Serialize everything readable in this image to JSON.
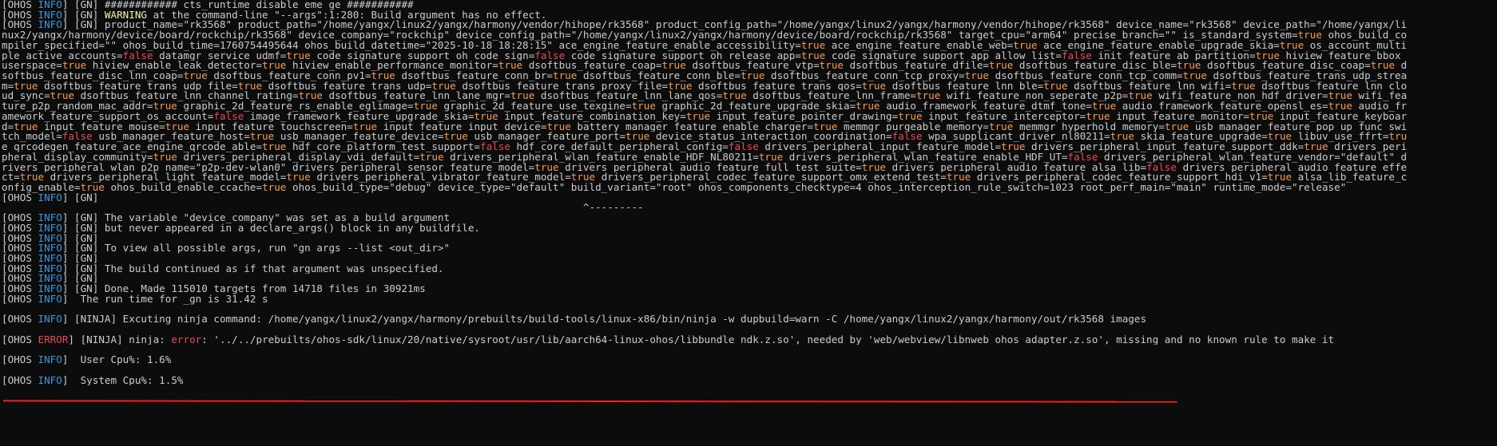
{
  "tags": {
    "info": "INFO",
    "error": "ERROR"
  },
  "colors": {
    "background": "#0c0c0c",
    "foreground": "#cccccc",
    "info_tag": "#3a96dd",
    "error_tag": "#e74856",
    "warning": "#f9f1a5",
    "bool_true": "#f59c4f",
    "bool_false": "#e74856",
    "annotation": "#ff1a1a"
  },
  "lines": [
    [
      [
        "",
        "[OHOS "
      ],
      [
        "info",
        "INFO"
      ],
      [
        "",
        "] [GN] ############ cts_runtime disable eme ge ###########"
      ]
    ],
    [
      [
        "",
        "[OHOS "
      ],
      [
        "info",
        "INFO"
      ],
      [
        "",
        "] [GN] "
      ],
      [
        "warn",
        "WARNING"
      ],
      [
        "",
        " at the command-line \"--args\":1:280: Build argument has no effect."
      ]
    ],
    [
      [
        "",
        "[OHOS "
      ],
      [
        "info",
        "INFO"
      ],
      [
        "",
        "] [GN] product_name=\"rk3568\" product_path=\"/home/yangx/linux2/yangx/harmony/vendor/hihope/rk3568\" product_config_path=\"/home/yangx/linux2/yangx/harmony/vendor/hihope/rk3568\" device_name=\"rk3568\" device_path=\"/home/yangx/li"
      ]
    ],
    [
      [
        "",
        "nux2/yangx/harmony/device/board/rockchip/rk3568\" device_company=\"rockchip\" device_config_path=\"/home/yangx/linux2/yangx/harmony/device/board/rockchip/rk3568\" target_cpu=\"arm64\" precise_branch=\"\" is_standard_system="
      ],
      [
        "t",
        "true"
      ],
      [
        "",
        " ohos_build_co"
      ]
    ],
    [
      [
        "",
        "mpiler_specified=\"\" ohos_build_time=1760754495644 ohos_build_datetime=\"2025-10-18 18:28:15\" ace_engine_feature_enable_accessibility="
      ],
      [
        "t",
        "true"
      ],
      [
        "",
        " ace_engine_feature_enable_web="
      ],
      [
        "t",
        "true"
      ],
      [
        "",
        " ace_engine_feature_enable_upgrade_skia="
      ],
      [
        "t",
        "true"
      ],
      [
        "",
        " os_account_multi"
      ]
    ],
    [
      [
        "",
        "ple_active_accounts="
      ],
      [
        "f",
        "false"
      ],
      [
        "",
        " datamgr_service_udmf="
      ],
      [
        "t",
        "true"
      ],
      [
        "",
        " code_signature_support_oh_code_sign="
      ],
      [
        "f",
        "false"
      ],
      [
        "",
        " code_signature_support_oh_release_app="
      ],
      [
        "t",
        "true"
      ],
      [
        "",
        " code_signature_support_app_allow_list="
      ],
      [
        "f",
        "false"
      ],
      [
        "",
        " init_feature_ab_partition="
      ],
      [
        "t",
        "true"
      ],
      [
        "",
        " hiview_feature_bbox_"
      ]
    ],
    [
      [
        "",
        "userspace="
      ],
      [
        "t",
        "true"
      ],
      [
        "",
        " hiview_enable_leak_detector="
      ],
      [
        "t",
        "true"
      ],
      [
        "",
        " hiview_enable_performance_monitor="
      ],
      [
        "t",
        "true"
      ],
      [
        "",
        " dsoftbus_feature_coap="
      ],
      [
        "t",
        "true"
      ],
      [
        "",
        " dsoftbus_feature_vtp="
      ],
      [
        "t",
        "true"
      ],
      [
        "",
        " dsoftbus_feature_dfile="
      ],
      [
        "t",
        "true"
      ],
      [
        "",
        " dsoftbus_feature_disc_ble="
      ],
      [
        "t",
        "true"
      ],
      [
        "",
        " dsoftbus_feature_disc_coap="
      ],
      [
        "t",
        "true"
      ],
      [
        "",
        " d"
      ]
    ],
    [
      [
        "",
        "softbus_feature_disc_lnn_coap="
      ],
      [
        "t",
        "true"
      ],
      [
        "",
        " dsoftbus_feature_conn_pv1="
      ],
      [
        "t",
        "true"
      ],
      [
        "",
        " dsoftbus_feature_conn_br="
      ],
      [
        "t",
        "true"
      ],
      [
        "",
        " dsoftbus_feature_conn_ble="
      ],
      [
        "t",
        "true"
      ],
      [
        "",
        " dsoftbus_feature_conn_tcp_proxy="
      ],
      [
        "t",
        "true"
      ],
      [
        "",
        " dsoftbus_feature_conn_tcp_comm="
      ],
      [
        "t",
        "true"
      ],
      [
        "",
        " dsoftbus_feature_trans_udp_strea"
      ]
    ],
    [
      [
        "",
        "m="
      ],
      [
        "t",
        "true"
      ],
      [
        "",
        " dsoftbus_feature_trans_udp_file="
      ],
      [
        "t",
        "true"
      ],
      [
        "",
        " dsoftbus_feature_trans_udp="
      ],
      [
        "t",
        "true"
      ],
      [
        "",
        " dsoftbus_feature_trans_proxy_file="
      ],
      [
        "t",
        "true"
      ],
      [
        "",
        " dsoftbus_feature_trans_qos="
      ],
      [
        "t",
        "true"
      ],
      [
        "",
        " dsoftbus_feature_lnn_ble="
      ],
      [
        "t",
        "true"
      ],
      [
        "",
        " dsoftbus_feature_lnn_wifi="
      ],
      [
        "t",
        "true"
      ],
      [
        "",
        " dsoftbus_feature_lnn_clo"
      ]
    ],
    [
      [
        "",
        "ud_sync="
      ],
      [
        "t",
        "true"
      ],
      [
        "",
        " dsoftbus_feature_lnn_channel_rating="
      ],
      [
        "t",
        "true"
      ],
      [
        "",
        " dsoftbus_feature_lnn_lane_mgr="
      ],
      [
        "t",
        "true"
      ],
      [
        "",
        " dsoftbus_feature_lnn_lane_qos="
      ],
      [
        "t",
        "true"
      ],
      [
        "",
        " dsoftbus_feature_lnn_frame="
      ],
      [
        "t",
        "true"
      ],
      [
        "",
        " wifi_feature_non_seperate_p2p="
      ],
      [
        "t",
        "true"
      ],
      [
        "",
        " wifi_feature_non_hdf_driver="
      ],
      [
        "t",
        "true"
      ],
      [
        "",
        " wifi_fea"
      ]
    ],
    [
      [
        "",
        "ture_p2p_random_mac_addr="
      ],
      [
        "t",
        "true"
      ],
      [
        "",
        " graphic_2d_feature_rs_enable_eglimage="
      ],
      [
        "t",
        "true"
      ],
      [
        "",
        " graphic_2d_feature_use_texgine="
      ],
      [
        "t",
        "true"
      ],
      [
        "",
        " graphic_2d_feature_upgrade_skia="
      ],
      [
        "t",
        "true"
      ],
      [
        "",
        " audio_framework_feature_dtmf_tone="
      ],
      [
        "t",
        "true"
      ],
      [
        "",
        " audio_framework_feature_opensl_es="
      ],
      [
        "t",
        "true"
      ],
      [
        "",
        " audio_fr"
      ]
    ],
    [
      [
        "",
        "amework_feature_support_os_account="
      ],
      [
        "f",
        "false"
      ],
      [
        "",
        " image_framework_feature_upgrade_skia="
      ],
      [
        "t",
        "true"
      ],
      [
        "",
        " input_feature_combination_key="
      ],
      [
        "t",
        "true"
      ],
      [
        "",
        " input_feature_pointer_drawing="
      ],
      [
        "t",
        "true"
      ],
      [
        "",
        " input_feature_interceptor="
      ],
      [
        "t",
        "true"
      ],
      [
        "",
        " input_feature_monitor="
      ],
      [
        "t",
        "true"
      ],
      [
        "",
        " input_feature_keyboar"
      ]
    ],
    [
      [
        "",
        "d="
      ],
      [
        "t",
        "true"
      ],
      [
        "",
        " input_feature_mouse="
      ],
      [
        "t",
        "true"
      ],
      [
        "",
        " input_feature_touchscreen="
      ],
      [
        "t",
        "true"
      ],
      [
        "",
        " input_feature_input_device="
      ],
      [
        "t",
        "true"
      ],
      [
        "",
        " battery_manager_feature_enable_charger="
      ],
      [
        "t",
        "true"
      ],
      [
        "",
        " memmgr_purgeable_memory="
      ],
      [
        "t",
        "true"
      ],
      [
        "",
        " memmgr_hyperhold_memory="
      ],
      [
        "t",
        "true"
      ],
      [
        "",
        " usb_manager_feature_pop_up_func_swi"
      ]
    ],
    [
      [
        "",
        "tch_model="
      ],
      [
        "f",
        "false"
      ],
      [
        "",
        " usb_manager_feature_host="
      ],
      [
        "t",
        "true"
      ],
      [
        "",
        " usb_manager_feature_device="
      ],
      [
        "t",
        "true"
      ],
      [
        "",
        " usb_manager_feature_port="
      ],
      [
        "t",
        "true"
      ],
      [
        "",
        " device_status_interaction_coordination="
      ],
      [
        "f",
        "false"
      ],
      [
        "",
        " wpa_supplicant_driver_nl80211="
      ],
      [
        "t",
        "true"
      ],
      [
        "",
        " skia_feature_upgrade="
      ],
      [
        "t",
        "true"
      ],
      [
        "",
        " libuv_use_ffrt="
      ],
      [
        "t",
        "tru"
      ]
    ],
    [
      [
        "",
        "e qrcodegen_feature_ace_engine_qrcode_able="
      ],
      [
        "t",
        "true"
      ],
      [
        "",
        " hdf_core_platform_test_support="
      ],
      [
        "f",
        "false"
      ],
      [
        "",
        " hdf_core_default_peripheral_config="
      ],
      [
        "f",
        "false"
      ],
      [
        "",
        " drivers_peripheral_input_feature_model="
      ],
      [
        "t",
        "true"
      ],
      [
        "",
        " drivers_peripheral_input_feature_support_ddk="
      ],
      [
        "t",
        "true"
      ],
      [
        "",
        " drivers_peri"
      ]
    ],
    [
      [
        "",
        "pheral_display_community="
      ],
      [
        "t",
        "true"
      ],
      [
        "",
        " drivers_peripheral_display_vdi_default="
      ],
      [
        "t",
        "true"
      ],
      [
        "",
        " drivers_peripheral_wlan_feature_enable_HDF_NL80211="
      ],
      [
        "t",
        "true"
      ],
      [
        "",
        " drivers_peripheral_wlan_feature_enable_HDF_UT="
      ],
      [
        "f",
        "false"
      ],
      [
        "",
        " drivers_peripheral_wlan_feature_vendor=\"default\" d"
      ]
    ],
    [
      [
        "",
        "rivers_peripheral_wlan_p2p_name=\"p2p-dev-wlan0\" drivers_peripheral_sensor_feature_model="
      ],
      [
        "t",
        "true"
      ],
      [
        "",
        " drivers_peripheral_audio_feature_full_test_suite="
      ],
      [
        "t",
        "true"
      ],
      [
        "",
        " drivers_peripheral_audio_feature_alsa_lib="
      ],
      [
        "f",
        "false"
      ],
      [
        "",
        " drivers_peripheral_audio_feature_effe"
      ]
    ],
    [
      [
        "",
        "ct="
      ],
      [
        "t",
        "true"
      ],
      [
        "",
        " drivers_peripheral_light_feature_model="
      ],
      [
        "t",
        "true"
      ],
      [
        "",
        " drivers_peripheral_vibrator_feature_model="
      ],
      [
        "t",
        "true"
      ],
      [
        "",
        " drivers_peripheral_codec_feature_support_omx_extend_test="
      ],
      [
        "t",
        "true"
      ],
      [
        "",
        " drivers_peripheral_codec_feature_support_hdi_v1="
      ],
      [
        "t",
        "true"
      ],
      [
        "",
        " alsa_lib_feature_c"
      ]
    ],
    [
      [
        "",
        "onfig_enable="
      ],
      [
        "t",
        "true"
      ],
      [
        "",
        " ohos_build_enable_ccache="
      ],
      [
        "t",
        "true"
      ],
      [
        "",
        " ohos_build_type=\"debug\" device_type=\"default\" build_variant=\"root\" ohos_components_checktype=4 ohos_interception_rule_switch=1023 root_perf_main=\"main\" runtime_mode=\"release\""
      ]
    ],
    [
      [
        "",
        "[OHOS "
      ],
      [
        "info",
        "INFO"
      ],
      [
        "",
        "] [GN]"
      ]
    ],
    [
      [
        "caret",
        "                                                                                                ^---------"
      ]
    ],
    [
      [
        "",
        "[OHOS "
      ],
      [
        "info",
        "INFO"
      ],
      [
        "",
        "] [GN] The variable \"device_company\" was set as a build argument"
      ]
    ],
    [
      [
        "",
        "[OHOS "
      ],
      [
        "info",
        "INFO"
      ],
      [
        "",
        "] [GN] but never appeared in a declare_args() block in any buildfile."
      ]
    ],
    [
      [
        "",
        "[OHOS "
      ],
      [
        "info",
        "INFO"
      ],
      [
        "",
        "] [GN]"
      ]
    ],
    [
      [
        "",
        "[OHOS "
      ],
      [
        "info",
        "INFO"
      ],
      [
        "",
        "] [GN] To view all possible args, run \"gn args --list <out_dir>\""
      ]
    ],
    [
      [
        "",
        "[OHOS "
      ],
      [
        "info",
        "INFO"
      ],
      [
        "",
        "] [GN]"
      ]
    ],
    [
      [
        "",
        "[OHOS "
      ],
      [
        "info",
        "INFO"
      ],
      [
        "",
        "] [GN] The build continued as if that argument was unspecified."
      ]
    ],
    [
      [
        "",
        "[OHOS "
      ],
      [
        "info",
        "INFO"
      ],
      [
        "",
        "] [GN]"
      ]
    ],
    [
      [
        "",
        "[OHOS "
      ],
      [
        "info",
        "INFO"
      ],
      [
        "",
        "] [GN] Done. Made 115010 targets from 14718 files in 30921ms"
      ]
    ],
    [
      [
        "",
        "[OHOS "
      ],
      [
        "info",
        "INFO"
      ],
      [
        "",
        "]  The run time for _gn is 31.42 s"
      ]
    ],
    [],
    [
      [
        "",
        "[OHOS "
      ],
      [
        "info",
        "INFO"
      ],
      [
        "",
        "] [NINJA] Excuting ninja command: /home/yangx/linux2/yangx/harmony/prebuilts/build-tools/linux-x86/bin/ninja -w dupbuild=warn -C /home/yangx/linux2/yangx/harmony/out/rk3568 images"
      ]
    ],
    [],
    [
      [
        "",
        "[OHOS "
      ],
      [
        "err",
        "ERROR"
      ],
      [
        "",
        "] [NINJA] ninja: "
      ],
      [
        "err",
        "error"
      ],
      [
        "",
        ": '../../prebuilts/ohos-sdk/linux/20/native/sysroot/usr/lib/aarch64-linux-ohos/libbundle_ndk.z.so', needed by 'web/webview/libnweb_ohos_adapter.z.so', missing and no known rule to make it"
      ]
    ],
    [],
    [
      [
        "",
        "[OHOS "
      ],
      [
        "info",
        "INFO"
      ],
      [
        "",
        "]  User Cpu%: 1.6%"
      ]
    ],
    [],
    [
      [
        "",
        "[OHOS "
      ],
      [
        "info",
        "INFO"
      ],
      [
        "",
        "]  System Cpu%: 1.5%"
      ]
    ]
  ]
}
